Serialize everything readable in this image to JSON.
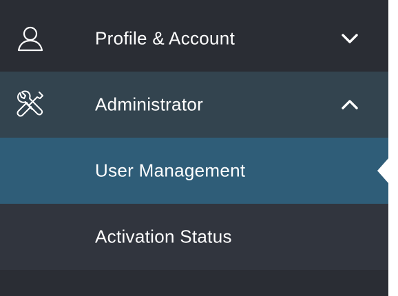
{
  "sidebar": {
    "items": [
      {
        "label": "Profile & Account",
        "icon": "user-icon",
        "chevron": "chevron-down-icon",
        "expanded": false
      },
      {
        "label": "Administrator",
        "icon": "tools-icon",
        "chevron": "chevron-up-icon",
        "expanded": true
      },
      {
        "label": "User Management",
        "active": true
      },
      {
        "label": "Activation Status",
        "active": false
      }
    ]
  },
  "colors": {
    "background": "#2a2d34",
    "section_expanded": "#33444f",
    "item_active": "#2f5d78",
    "item_default": "#31353e",
    "text": "#ffffff"
  }
}
